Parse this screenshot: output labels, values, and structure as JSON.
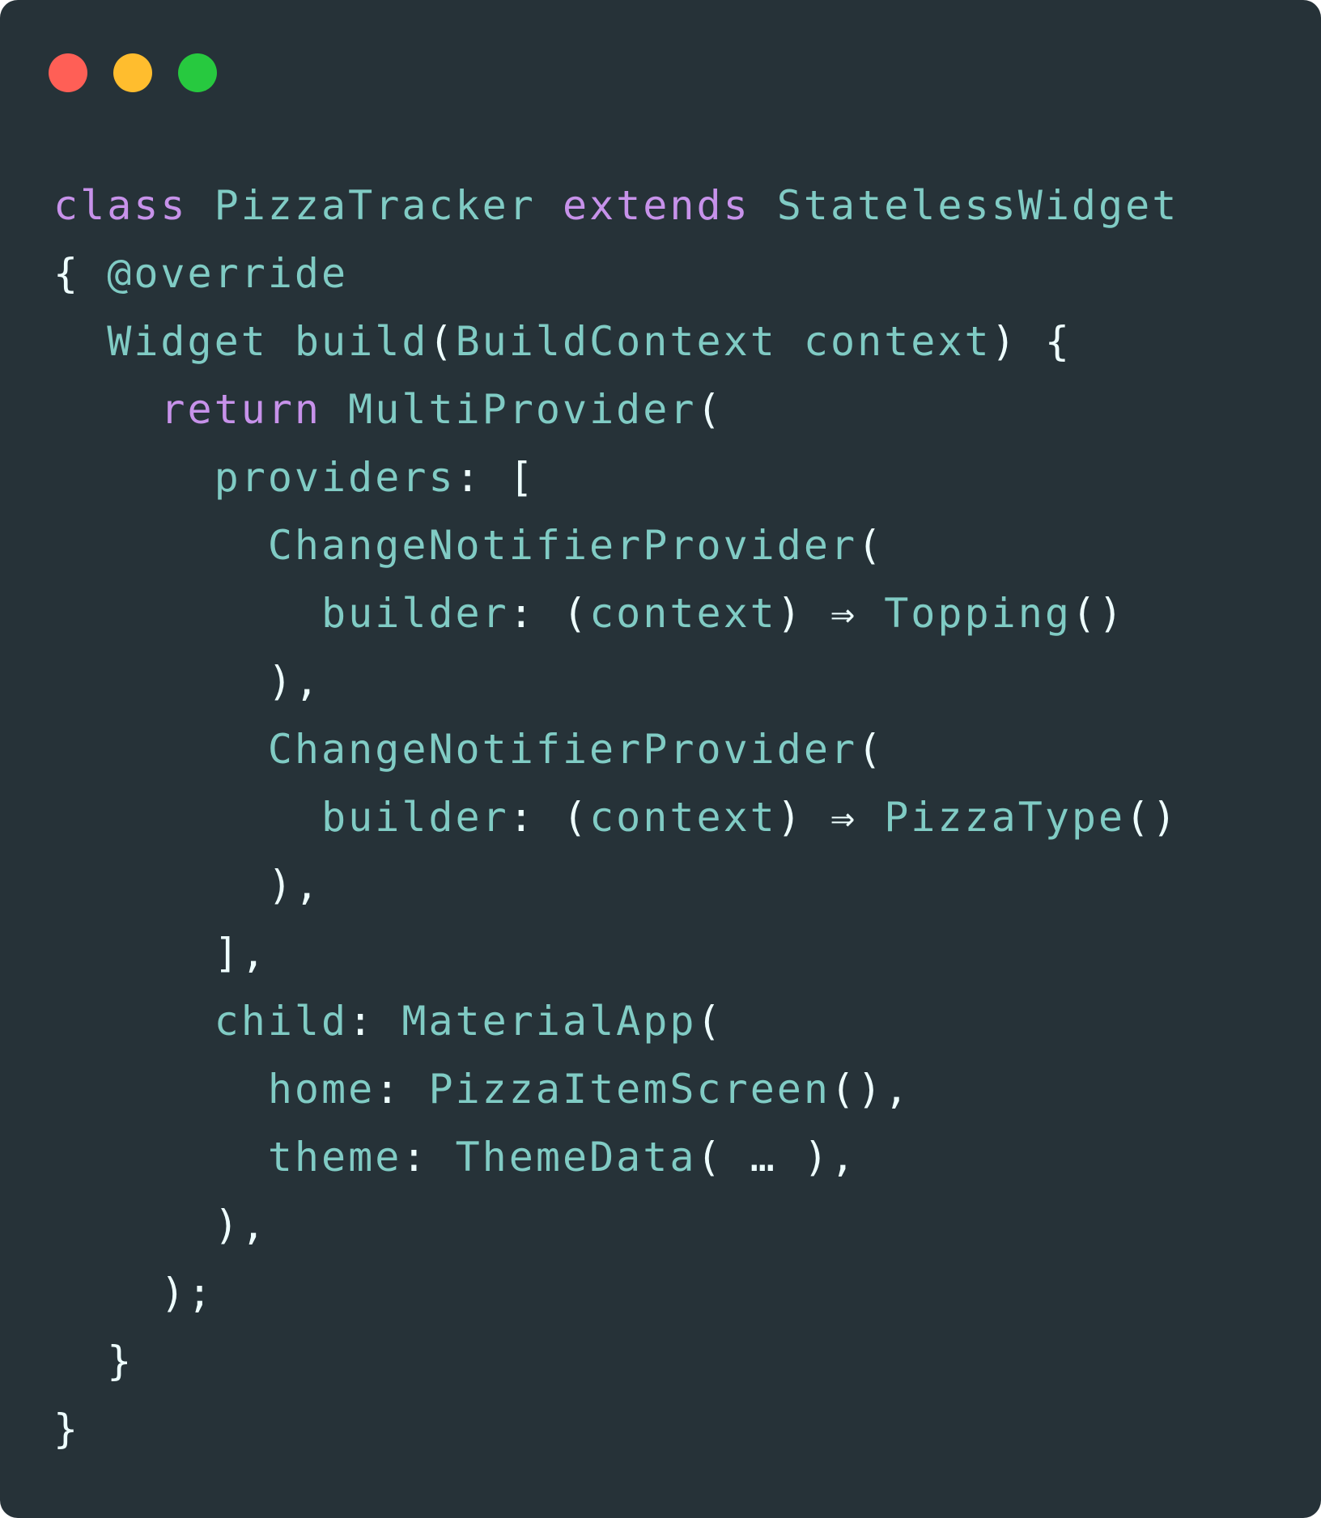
{
  "window": {
    "traffic_lights": [
      {
        "name": "close",
        "color": "#ff5f56"
      },
      {
        "name": "minimize",
        "color": "#ffbd2e"
      },
      {
        "name": "maximize",
        "color": "#27c93f"
      }
    ]
  },
  "theme": {
    "background": "#263238",
    "keyword_color": "#c792ea",
    "identifier_color": "#80cbc4",
    "punctuation_color": "#eeffff"
  },
  "code_lines": [
    [
      {
        "t": "class",
        "k": "kw"
      },
      {
        "t": " ",
        "k": "id"
      },
      {
        "t": "PizzaTracker",
        "k": "id"
      },
      {
        "t": " ",
        "k": "id"
      },
      {
        "t": "extends",
        "k": "kw"
      },
      {
        "t": " ",
        "k": "id"
      },
      {
        "t": "StatelessWidget",
        "k": "id"
      }
    ],
    [
      {
        "t": "{",
        "k": "p"
      },
      {
        "t": " ",
        "k": "id"
      },
      {
        "t": "@override",
        "k": "id"
      }
    ],
    [
      {
        "t": "  ",
        "k": "id"
      },
      {
        "t": "Widget build",
        "k": "id"
      },
      {
        "t": "(",
        "k": "p"
      },
      {
        "t": "BuildContext context",
        "k": "id"
      },
      {
        "t": ") {",
        "k": "p"
      }
    ],
    [
      {
        "t": "    ",
        "k": "id"
      },
      {
        "t": "return",
        "k": "kw"
      },
      {
        "t": " ",
        "k": "id"
      },
      {
        "t": "MultiProvider",
        "k": "id"
      },
      {
        "t": "(",
        "k": "p"
      }
    ],
    [
      {
        "t": "      ",
        "k": "id"
      },
      {
        "t": "providers",
        "k": "id"
      },
      {
        "t": ": [",
        "k": "p"
      }
    ],
    [
      {
        "t": "        ",
        "k": "id"
      },
      {
        "t": "ChangeNotifierProvider",
        "k": "id"
      },
      {
        "t": "(",
        "k": "p"
      }
    ],
    [
      {
        "t": "          ",
        "k": "id"
      },
      {
        "t": "builder",
        "k": "id"
      },
      {
        "t": ": (",
        "k": "p"
      },
      {
        "t": "context",
        "k": "id"
      },
      {
        "t": ") ⇒ ",
        "k": "p"
      },
      {
        "t": "Topping",
        "k": "id"
      },
      {
        "t": "()",
        "k": "p"
      }
    ],
    [
      {
        "t": "        ",
        "k": "id"
      },
      {
        "t": "),",
        "k": "p"
      }
    ],
    [
      {
        "t": "        ",
        "k": "id"
      },
      {
        "t": "ChangeNotifierProvider",
        "k": "id"
      },
      {
        "t": "(",
        "k": "p"
      }
    ],
    [
      {
        "t": "          ",
        "k": "id"
      },
      {
        "t": "builder",
        "k": "id"
      },
      {
        "t": ": (",
        "k": "p"
      },
      {
        "t": "context",
        "k": "id"
      },
      {
        "t": ") ⇒ ",
        "k": "p"
      },
      {
        "t": "PizzaType",
        "k": "id"
      },
      {
        "t": "()",
        "k": "p"
      }
    ],
    [
      {
        "t": "        ",
        "k": "id"
      },
      {
        "t": "),",
        "k": "p"
      }
    ],
    [
      {
        "t": "      ",
        "k": "id"
      },
      {
        "t": "],",
        "k": "p"
      }
    ],
    [
      {
        "t": "      ",
        "k": "id"
      },
      {
        "t": "child",
        "k": "id"
      },
      {
        "t": ": ",
        "k": "p"
      },
      {
        "t": "MaterialApp",
        "k": "id"
      },
      {
        "t": "(",
        "k": "p"
      }
    ],
    [
      {
        "t": "        ",
        "k": "id"
      },
      {
        "t": "home",
        "k": "id"
      },
      {
        "t": ": ",
        "k": "p"
      },
      {
        "t": "PizzaItemScreen",
        "k": "id"
      },
      {
        "t": "(),",
        "k": "p"
      }
    ],
    [
      {
        "t": "        ",
        "k": "id"
      },
      {
        "t": "theme",
        "k": "id"
      },
      {
        "t": ": ",
        "k": "p"
      },
      {
        "t": "ThemeData",
        "k": "id"
      },
      {
        "t": "( … ),",
        "k": "p"
      }
    ],
    [
      {
        "t": "      ",
        "k": "id"
      },
      {
        "t": "),",
        "k": "p"
      }
    ],
    [
      {
        "t": "    ",
        "k": "id"
      },
      {
        "t": ");",
        "k": "p"
      }
    ],
    [
      {
        "t": "  ",
        "k": "id"
      },
      {
        "t": "}",
        "k": "p"
      }
    ],
    [
      {
        "t": "}",
        "k": "p"
      }
    ]
  ]
}
